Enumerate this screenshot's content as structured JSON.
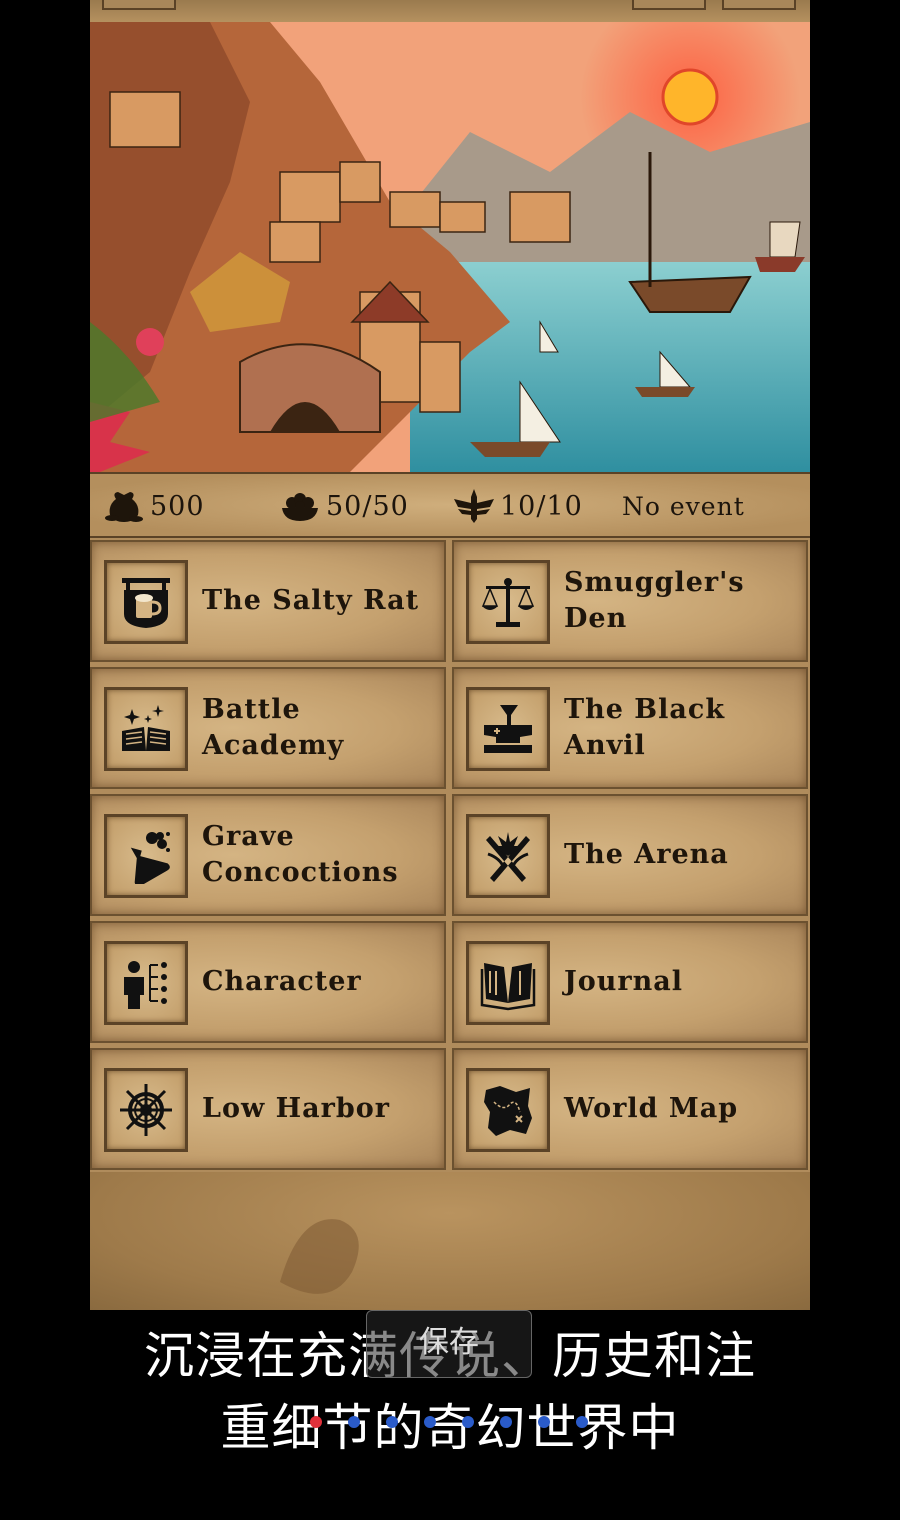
{
  "stats": {
    "gold": "500",
    "supplies": "50/50",
    "energy": "10/10",
    "event": "No event"
  },
  "locations": [
    {
      "label": "The Salty Rat",
      "icon": "tavern-icon"
    },
    {
      "label": "Smuggler's Den",
      "icon": "scales-icon"
    },
    {
      "label": "Battle Academy",
      "icon": "spellbook-icon"
    },
    {
      "label": "The Black Anvil",
      "icon": "anvil-icon"
    },
    {
      "label": "Grave Concoctions",
      "icon": "potion-icon"
    },
    {
      "label": "The Arena",
      "icon": "crossed-swords-icon"
    },
    {
      "label": "Character",
      "icon": "character-tree-icon"
    },
    {
      "label": "Journal",
      "icon": "journal-icon"
    },
    {
      "label": "Low Harbor",
      "icon": "ship-wheel-icon"
    },
    {
      "label": "World Map",
      "icon": "treasure-map-icon"
    }
  ],
  "caption": {
    "line1": "沉浸在充满传说、历史和注",
    "line2": "重细节的奇幻世界中"
  },
  "save_button": "保存",
  "carousel": {
    "active_index": 0,
    "count": 8,
    "active_color": "#e0303a",
    "inactive_color": "#2a5bc9"
  }
}
